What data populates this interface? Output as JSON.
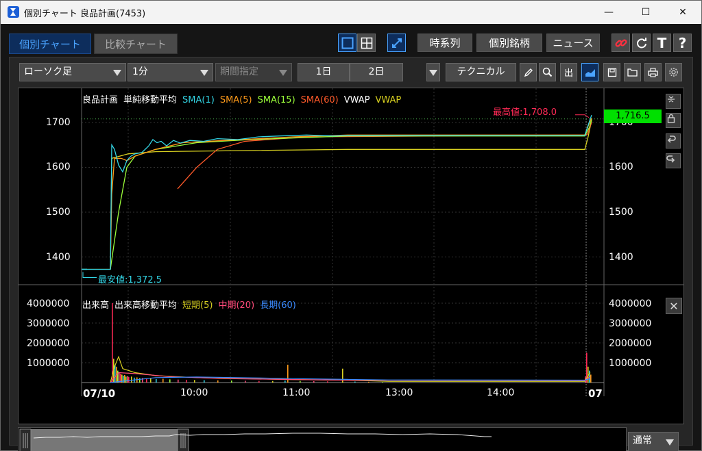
{
  "window": {
    "title": "個別チャート 良品計画(7453)",
    "minimize": "—",
    "maximize": "☐",
    "close": "✕"
  },
  "tabs": [
    {
      "label": "個別チャート",
      "active": true
    },
    {
      "label": "比較チャート",
      "active": false
    }
  ],
  "topbar": {
    "timeseries": "時系列",
    "individual": "個別銘柄",
    "news": "ニュース",
    "text_icon": "T",
    "help_icon": "?"
  },
  "controls": {
    "chart_type": "ローソク足",
    "interval": "1分",
    "period": "期間指定",
    "day1": "1日",
    "day2": "2日",
    "technical": "テクニカル",
    "out_label": "出"
  },
  "price_chart": {
    "legend": [
      {
        "label": "良品計画",
        "color": "#ffffff"
      },
      {
        "label": "単純移動平均",
        "color": "#ffffff"
      },
      {
        "label": "SMA(1)",
        "color": "#33d6e6"
      },
      {
        "label": "SMA(5)",
        "color": "#ff9a1a"
      },
      {
        "label": "SMA(15)",
        "color": "#9cff3a"
      },
      {
        "label": "SMA(60)",
        "color": "#ff5a2a"
      },
      {
        "label": "VWAP",
        "color": "#ffffff"
      },
      {
        "label": "VWAP",
        "color": "#d8d020"
      }
    ],
    "y_ticks_left": [
      "1700",
      "1600",
      "1500",
      "1400"
    ],
    "y_ticks_right": [
      "1700",
      "1600",
      "1500",
      "1400"
    ],
    "current_price": "1,716.5",
    "high_label": "最高値:1,708.0",
    "low_label": "最安値:1,372.5",
    "colors": {
      "sma1": "#33d6e6",
      "sma5": "#ff9a1a",
      "sma15": "#9cff3a",
      "sma60": "#ff5a2a",
      "vwap": "#d8d020",
      "high": "#ff2a55",
      "low": "#33d6e6"
    }
  },
  "volume_chart": {
    "legend": [
      {
        "label": "出来高",
        "color": "#ffffff"
      },
      {
        "label": "出来高移動平均",
        "color": "#ffffff"
      },
      {
        "label": "短期(5)",
        "color": "#d8d020"
      },
      {
        "label": "中期(20)",
        "color": "#ff4a7a"
      },
      {
        "label": "長期(60)",
        "color": "#3a8aff"
      }
    ],
    "y_ticks_left": [
      "4000000",
      "3000000",
      "2000000",
      "1000000"
    ],
    "y_ticks_right": [
      "4000000",
      "3000000",
      "2000000",
      "1000000"
    ],
    "close_icon": "✕"
  },
  "x_axis": [
    "07/10",
    "10:00",
    "11:00",
    "13:00",
    "14:00",
    "07"
  ],
  "mode_select": "通常"
}
